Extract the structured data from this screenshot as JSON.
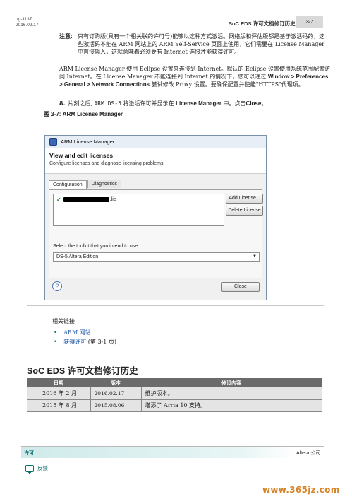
{
  "header": {
    "doc_id": "ug-1137",
    "date": "2016.02.17",
    "title": "SoC EDS 许可文档修订历史",
    "page_num": "3-7"
  },
  "note": {
    "label": "注意:",
    "text": "只有订购版(具有一个相关联的许可号)能够以这种方式激活。网络版和评估版都是基于激活码的，这些激活码不能在 ARM 网站上的 ARM Self-Service 页面上使用，它们需要在 License Manager 中直接输入，这就意味着必须要有 Internet 连接才能获得许可。"
  },
  "paragraph": {
    "part1": "ARM License Manager 使用 Eclipse 设置来连接到 Internet。默认的 Eclipse 设置使用系统范围配置访问 Internet。在 License Manager 不能连接到 Internet 的情况下，您可以通过 ",
    "menu_path": "Window > Preferences > General > Network Connections",
    "part2": " 尝试修改 Proxy 设置。要确保配置并使能\"HTTPS\"代理项。"
  },
  "step": {
    "number": "8.",
    "pre": "片刻之后,",
    "code": "ARM DS-5",
    "mid": "将激活许可并显示在",
    "bold1": "License Manager",
    "mid2": "中。点击",
    "bold2": "Close",
    "end": "。"
  },
  "figure_caption": "图 3-7: ARM License Manager",
  "dialog": {
    "title": "ARM License Manager",
    "heading": "View and edit licenses",
    "subheading": "Configure licenses and diagnose licensing problems.",
    "tabs": [
      "Configuration",
      "Diagnostics"
    ],
    "license_suffix": ".lic",
    "add_button": "Add License...",
    "delete_button": "Delete License",
    "toolkit_label": "Select the toolkit that you intend to use:",
    "toolkit_value": "DS-5 Altera Edition",
    "close_button": "Close",
    "help_glyph": "?"
  },
  "related": {
    "label": "相关链接",
    "links": [
      {
        "text": "ARM 网站",
        "suffix": ""
      },
      {
        "text": "获得许可",
        "suffix": " (第 3-1 页)"
      }
    ]
  },
  "section_title": "SoC EDS 许可文档修订历史",
  "revision_table": {
    "headers": [
      "日期",
      "版本",
      "修订内容"
    ],
    "rows": [
      [
        "2016 年 2 月",
        "2016.02.17",
        "维护版本。"
      ],
      [
        "2015 年 8 月",
        "2015.08.06",
        "增添了 Arria 10 支持。"
      ]
    ]
  },
  "footer": {
    "left": "许可",
    "right": "Altera 公司",
    "feedback": "反馈"
  },
  "watermark": "www.365jz.com",
  "colors": {
    "accent_teal": "#0a6e6a",
    "link_blue": "#1f58a8",
    "table_header": "#6b6b6b",
    "watermark": "#d48428"
  }
}
